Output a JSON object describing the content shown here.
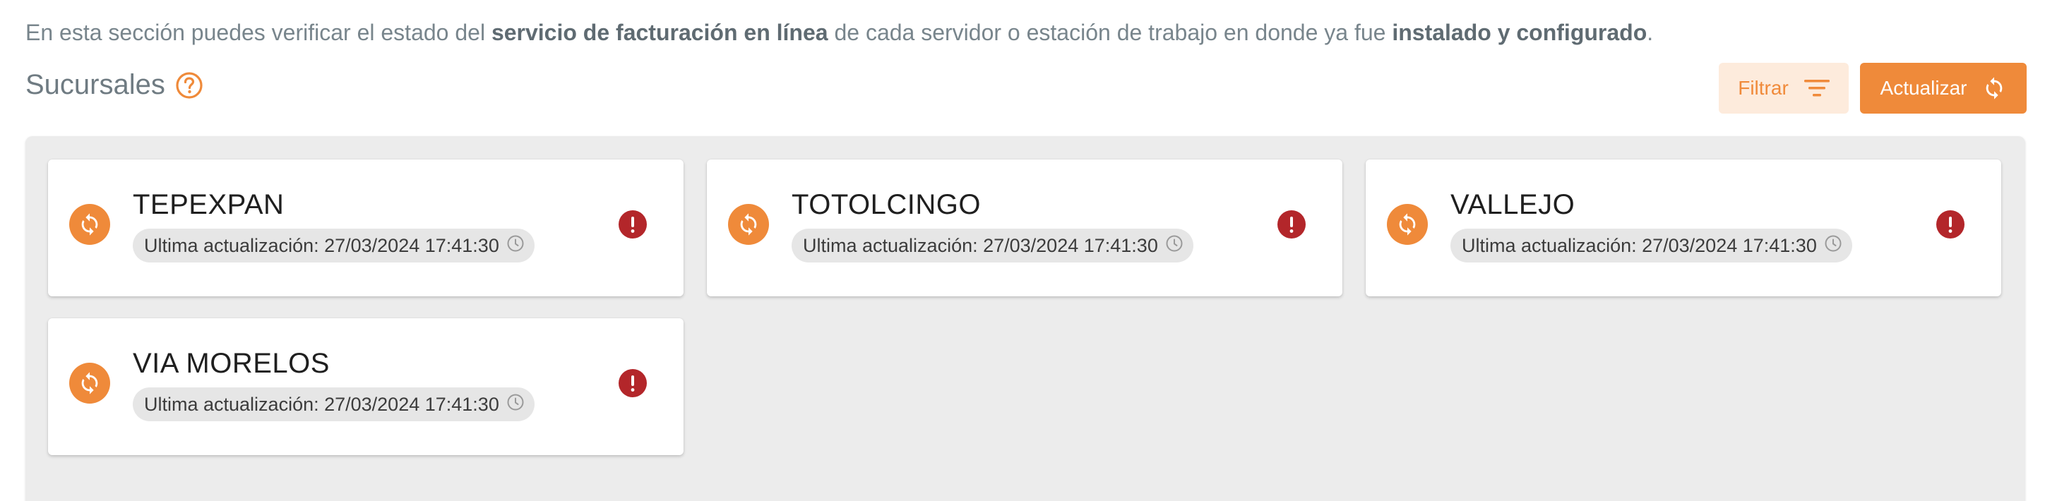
{
  "intro": {
    "part1": "En esta sección puedes verificar el estado del ",
    "bold1": "servicio de facturación en línea",
    "part2": " de cada servidor o estación de trabajo en donde ya fue ",
    "bold2": "instalado y configurado",
    "part3": "."
  },
  "section": {
    "title": "Sucursales",
    "help_icon": "help-circle-icon"
  },
  "toolbar": {
    "filter_label": "Filtrar",
    "filter_icon": "filter-lines-icon",
    "update_label": "Actualizar",
    "update_icon": "sync-icon"
  },
  "colors": {
    "accent": "#ef8a3a",
    "accent_light": "#fdebdc",
    "error": "#b3262a",
    "panel": "#ececec"
  },
  "branches": [
    {
      "name": "TEPEXPAN",
      "last_update": "Ultima actualización: 27/03/2024 17:41:30",
      "status_icon": "sync-icon",
      "alert_icon": "error-icon"
    },
    {
      "name": "TOTOLCINGO",
      "last_update": "Ultima actualización: 27/03/2024 17:41:30",
      "status_icon": "sync-icon",
      "alert_icon": "error-icon"
    },
    {
      "name": "VALLEJO",
      "last_update": "Ultima actualización: 27/03/2024 17:41:30",
      "status_icon": "sync-icon",
      "alert_icon": "error-icon"
    },
    {
      "name": "VIA MORELOS",
      "last_update": "Ultima actualización: 27/03/2024 17:41:30",
      "status_icon": "sync-icon",
      "alert_icon": "error-icon"
    }
  ]
}
